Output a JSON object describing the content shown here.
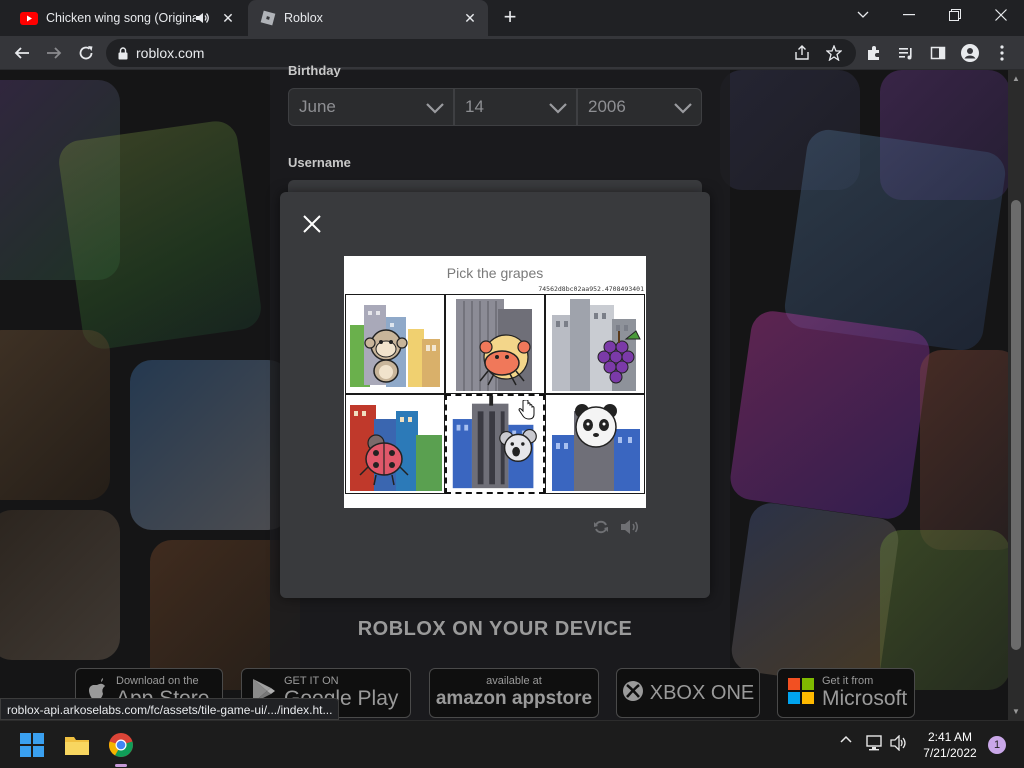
{
  "browser": {
    "tabs": [
      {
        "title": "Chicken wing song (Original)",
        "favicon": "youtube-icon",
        "playing_audio": true
      },
      {
        "title": "Roblox",
        "favicon": "roblox-icon",
        "active": true
      }
    ],
    "url": "roblox.com",
    "status_link": "roblox-api.arkoselabs.com/fc/assets/tile-game-ui/.../index.ht..."
  },
  "signup": {
    "birthday_label": "Birthday",
    "month": "June",
    "day": "14",
    "year": "2006",
    "username_label": "Username"
  },
  "captcha": {
    "prompt": "Pick the grapes",
    "session_id": "74562d8bc02aa952.4708493401",
    "tiles": [
      {
        "animal": "monkey",
        "selected": false
      },
      {
        "animal": "crab",
        "selected": false
      },
      {
        "animal": "grapes",
        "selected": false
      },
      {
        "animal": "ladybug",
        "selected": false
      },
      {
        "animal": "koala",
        "selected": true
      },
      {
        "animal": "panda",
        "selected": false
      }
    ]
  },
  "device_section": {
    "title": "ROBLOX ON YOUR DEVICE",
    "stores": [
      {
        "small": "Download on the",
        "big": "App Store",
        "icon": "apple-icon"
      },
      {
        "small": "GET IT ON",
        "big": "Google Play",
        "icon": "google-play-icon"
      },
      {
        "small": "available at",
        "big": "amazon appstore",
        "icon": "amazon-icon"
      },
      {
        "small": "",
        "big": "XBOX ONE",
        "icon": "xbox-icon"
      },
      {
        "small": "Get it from",
        "big": "Microsoft",
        "icon": "microsoft-icon"
      }
    ]
  },
  "taskbar": {
    "time": "2:41 AM",
    "date": "7/21/2022",
    "notification_count": "1"
  },
  "colors": {
    "browser_frame": "#202124",
    "toolbar": "#35363a",
    "modal": "#393a3d",
    "page_bg": "#151516"
  }
}
